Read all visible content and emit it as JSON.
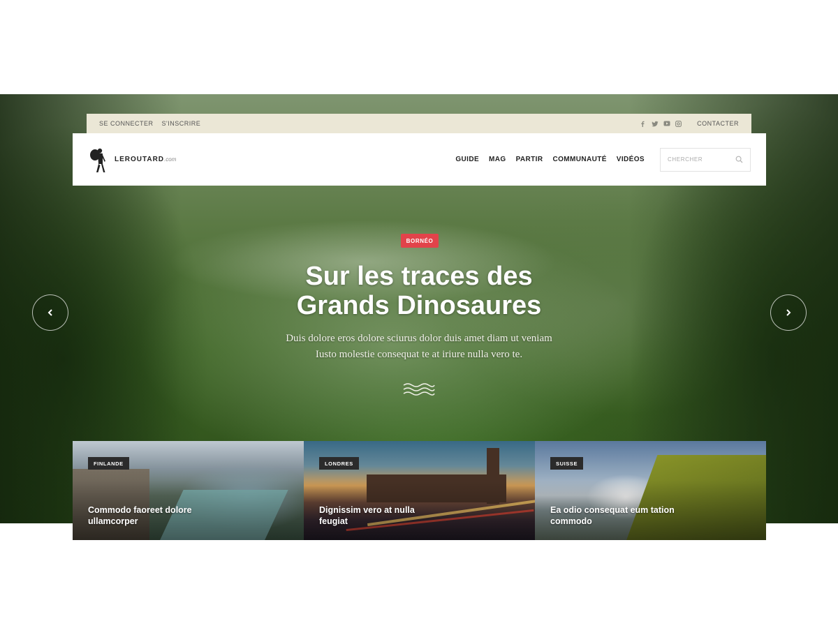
{
  "topbar": {
    "login": "SE CONNECTER",
    "signup": "S'INSCRIRE",
    "contact": "CONTACTER",
    "social": [
      "facebook-icon",
      "twitter-icon",
      "youtube-icon",
      "instagram-icon"
    ]
  },
  "header": {
    "logo_name": "LEROUTARD",
    "logo_suffix": ".com",
    "nav": [
      "GUIDE",
      "MAG",
      "PARTIR",
      "COMMUNAUTÉ",
      "VIDÉOS"
    ],
    "search_placeholder": "CHERCHER"
  },
  "hero": {
    "badge": "BORNÉO",
    "title_line1": "Sur les traces des",
    "title_line2": "Grands Dinosaures",
    "subtitle_line1": "Duis dolore eros dolore sciurus dolor duis amet diam ut veniam",
    "subtitle_line2": "Iusto molestie consequat te at iriure nulla vero te."
  },
  "cards": [
    {
      "tag": "FINLANDE",
      "title": "Commodo faoreet dolore ullamcorper"
    },
    {
      "tag": "LONDRES",
      "title": "Dignissim vero at nulla feugiat"
    },
    {
      "tag": "SUISSE",
      "title": "Ea odio consequat eum tation commodo"
    }
  ],
  "colors": {
    "badge": "#e2434a",
    "topbar_bg": "#ebe7d6",
    "card_tag_bg": "#2b2b2b"
  }
}
